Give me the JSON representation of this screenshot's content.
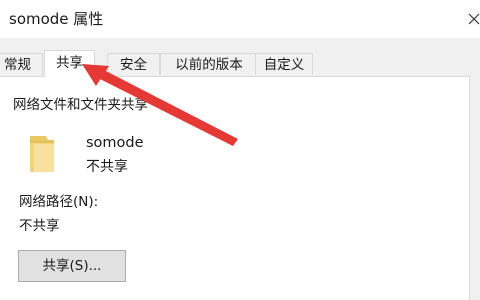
{
  "window": {
    "title": "somode 属性",
    "close_icon": "close-icon"
  },
  "tabs": [
    {
      "label": "常规",
      "selected": false
    },
    {
      "label": "共享",
      "selected": true
    },
    {
      "label": "安全",
      "selected": false
    },
    {
      "label": "以前的版本",
      "selected": false
    },
    {
      "label": "自定义",
      "selected": false
    }
  ],
  "sharing": {
    "group_label": "网络文件和文件夹共享",
    "item_icon": "folder-icon",
    "item_name": "somode",
    "item_status": "不共享",
    "path_label": "网络路径(N):",
    "path_value": "不共享",
    "share_button_label": "共享(S)..."
  },
  "annotation": {
    "arrow_color": "#e53935",
    "arrow_icon": "red-arrow-annotation"
  }
}
